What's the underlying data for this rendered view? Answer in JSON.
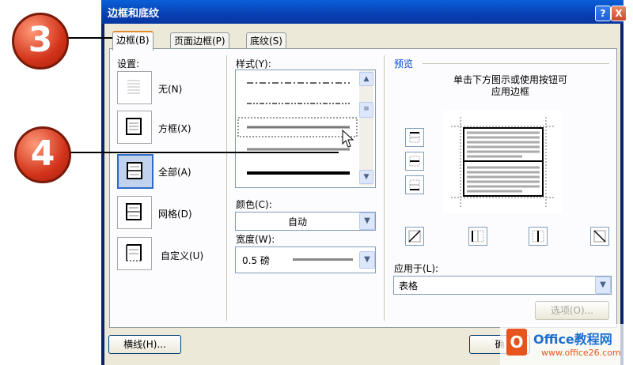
{
  "dialog": {
    "title": "边框和底纹",
    "help_icon": "?",
    "close_icon": "X"
  },
  "tabs": [
    {
      "label": "边框(B)",
      "active": true
    },
    {
      "label": "页面边框(P)",
      "active": false
    },
    {
      "label": "底纹(S)",
      "active": false
    }
  ],
  "settings": {
    "heading": "设置:",
    "items": [
      {
        "label": "无(N)"
      },
      {
        "label": "方框(X)"
      },
      {
        "label": "全部(A)",
        "selected": true
      },
      {
        "label": "网格(D)"
      },
      {
        "label": "自定义(U)"
      }
    ]
  },
  "style": {
    "heading": "样式(Y):"
  },
  "color": {
    "heading": "颜色(C):",
    "value": "自动"
  },
  "width": {
    "heading": "宽度(W):",
    "value": "0.5 磅"
  },
  "preview": {
    "heading": "预览",
    "instruction_line1": "单击下方图示或使用按钮可",
    "instruction_line2": "应用边框"
  },
  "apply": {
    "heading": "应用于(L):",
    "value": "表格"
  },
  "buttons": {
    "horizontal_line": "横线(H)...",
    "options": "选项(O)...",
    "ok": "确"
  },
  "callouts": {
    "step_a": "3",
    "step_b": "4"
  },
  "watermark": {
    "text": "Office教程网",
    "url": "www.office26.com"
  }
}
